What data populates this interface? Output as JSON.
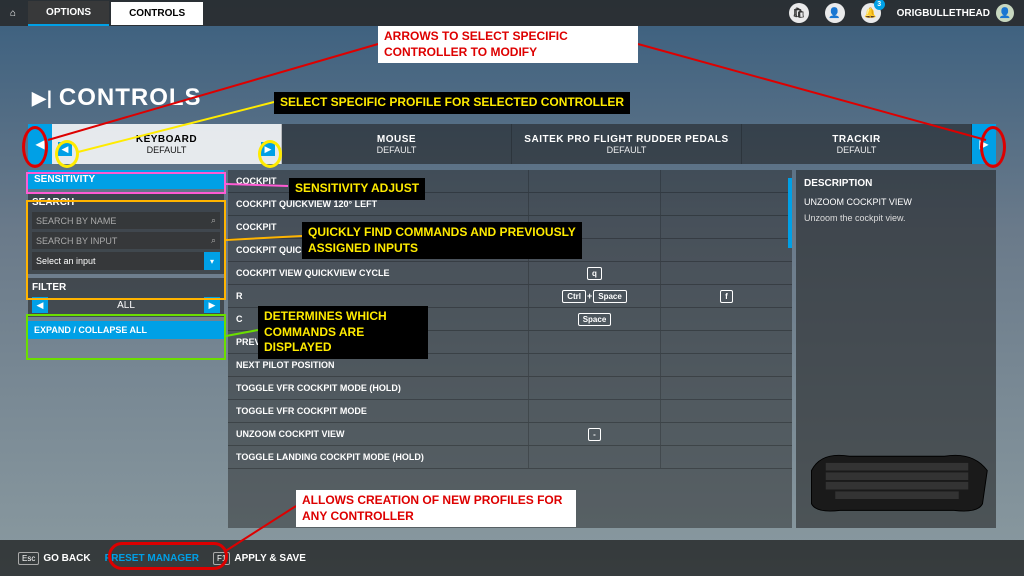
{
  "topbar": {
    "options_label": "OPTIONS",
    "controls_label": "CONTROLS",
    "notification_count": "3",
    "username": "ORIGBULLETHEAD"
  },
  "page_title": "CONTROLS",
  "controllers": [
    {
      "name": "KEYBOARD",
      "profile": "DEFAULT"
    },
    {
      "name": "MOUSE",
      "profile": "DEFAULT"
    },
    {
      "name": "SAITEK PRO FLIGHT RUDDER PEDALS",
      "profile": "DEFAULT"
    },
    {
      "name": "TRACKIR",
      "profile": "DEFAULT"
    }
  ],
  "left": {
    "sensitivity": "SENSITIVITY",
    "search_title": "SEARCH",
    "search_name_ph": "SEARCH BY NAME",
    "search_input_ph": "SEARCH BY INPUT",
    "select_input": "Select an input",
    "filter_title": "FILTER",
    "filter_value": "ALL",
    "expand": "EXPAND / COLLAPSE ALL"
  },
  "commands": [
    {
      "label": "COCKPIT",
      "b1": "",
      "b2": ""
    },
    {
      "label": "COCKPIT QUICKVIEW 120° LEFT",
      "b1": "",
      "b2": ""
    },
    {
      "label": "COCKPIT",
      "b1": "",
      "b2": ""
    },
    {
      "label": "COCKPIT QUICKVIEW 120° RIGHT",
      "b1": "",
      "b2": ""
    },
    {
      "label": "COCKPIT VIEW QUICKVIEW CYCLE",
      "b1": "q",
      "b2": ""
    },
    {
      "label": "R",
      "b1": "Ctrl+Space",
      "b2": "f"
    },
    {
      "label": "C",
      "b1": "Space",
      "b2": ""
    },
    {
      "label": "PREVIOUS PILOT POSITION",
      "b1": "",
      "b2": ""
    },
    {
      "label": "NEXT PILOT POSITION",
      "b1": "",
      "b2": ""
    },
    {
      "label": "TOGGLE VFR COCKPIT MODE (HOLD)",
      "b1": "",
      "b2": ""
    },
    {
      "label": "TOGGLE VFR COCKPIT MODE",
      "b1": "",
      "b2": ""
    },
    {
      "label": "UNZOOM COCKPIT VIEW",
      "b1": "-",
      "b2": ""
    },
    {
      "label": "TOGGLE LANDING COCKPIT MODE (HOLD)",
      "b1": "",
      "b2": ""
    }
  ],
  "description": {
    "title": "DESCRIPTION",
    "name": "UNZOOM COCKPIT VIEW",
    "text": "Unzoom the cockpit view."
  },
  "bottombar": {
    "goback_key": "Esc",
    "goback": "GO BACK",
    "preset": "PRESET MANAGER",
    "apply_key": "F1",
    "apply": "APPLY & SAVE"
  },
  "annotations": {
    "arrows": "ARROWS TO SELECT SPECIFIC CONTROLLER TO MODIFY",
    "profile": "SELECT SPECIFIC PROFILE FOR SELECTED CONTROLLER",
    "sensitivity": "SENSITIVITY ADJUST",
    "search": "QUICKLY FIND COMMANDS AND PREVIOUSLY ASSIGNED INPUTS",
    "filter": "DETERMINES WHICH COMMANDS ARE DISPLAYED",
    "preset": "ALLOWS CREATION OF NEW PROFILES FOR ANY CONTROLLER"
  }
}
